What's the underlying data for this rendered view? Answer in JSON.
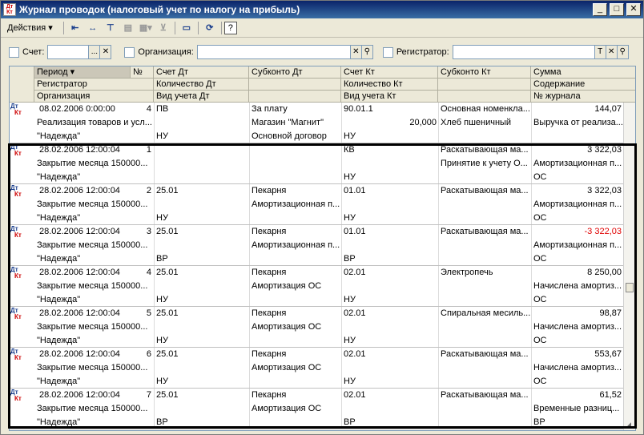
{
  "window": {
    "title": "Журнал проводок (налоговый учет по налогу на прибыль)",
    "app_icon": "1C-icon",
    "controls": [
      "_",
      "□",
      "✕"
    ]
  },
  "toolbar": {
    "actions_label": "Действия",
    "tools": [
      "arrow-left-icon",
      "expand-icon",
      "filter-icon",
      "copy-icon",
      "report-icon",
      "clear-filter-icon",
      "card-icon",
      "refresh-icon"
    ],
    "help_label": "?"
  },
  "filters": {
    "account_label": "Счет:",
    "account_value": "",
    "organization_label": "Организация:",
    "organization_value": "",
    "registrar_label": "Регистратор:",
    "registrar_value": "",
    "btn_more": "...",
    "btn_clear": "✕",
    "btn_t": "T"
  },
  "columns": {
    "row1": [
      "Период",
      "№",
      "Счет Дт",
      "Субконто Дт",
      "Счет Кт",
      "Субконто Кт",
      "Сумма"
    ],
    "row2": [
      "Регистратор",
      "Количество Дт",
      "Количество Кт",
      "Содержание"
    ],
    "row3": [
      "Организация",
      "Вид учета Дт",
      "Вид учета Кт",
      "№ журнала"
    ]
  },
  "rows": [
    {
      "icon_dt": "Дт",
      "icon_kt": "Кт",
      "period": "08.02.2006 0:00:00",
      "num": "4",
      "acc_dt": "ПВ",
      "sub_dt1": "За плату",
      "sub_dt2": "Магазин \"Магнит\"",
      "sub_dt3": "Основной договор",
      "acc_kt": "90.01.1",
      "qty_kt": "20,000",
      "sub_kt1": "Основная номенкла...",
      "sub_kt2": "Хлеб пшеничный",
      "sum": "144,07",
      "content": "Выручка от реализа...",
      "registrar": "Реализация товаров и усл...",
      "org": "\"Надежда\"",
      "vu_dt": "НУ",
      "vu_kt": "НУ",
      "journal": "",
      "negative": false
    },
    {
      "icon_dt": "Дт",
      "icon_kt": "Кт",
      "period": "28.02.2006 12:00:04",
      "num": "1",
      "acc_dt": "",
      "sub_dt1": "",
      "sub_dt2": "",
      "sub_dt3": "",
      "acc_kt": "КВ",
      "qty_kt": "",
      "sub_kt1": "Раскатывающая ма...",
      "sub_kt2": "Принятие к учету О...",
      "sum": "3 322,03",
      "content": "Амортизационная п...",
      "registrar": "Закрытие месяца 150000...",
      "org": "\"Надежда\"",
      "vu_dt": "",
      "vu_kt": "НУ",
      "journal": "ОС",
      "negative": false
    },
    {
      "icon_dt": "Дт",
      "icon_kt": "Кт",
      "period": "28.02.2006 12:00:04",
      "num": "2",
      "acc_dt": "25.01",
      "sub_dt1": "Пекарня",
      "sub_dt2": "Амортизационная п...",
      "sub_dt3": "",
      "acc_kt": "01.01",
      "qty_kt": "",
      "sub_kt1": "Раскатывающая ма...",
      "sub_kt2": "",
      "sum": "3 322,03",
      "content": "Амортизационная п...",
      "registrar": "Закрытие месяца 150000...",
      "org": "\"Надежда\"",
      "vu_dt": "НУ",
      "vu_kt": "НУ",
      "journal": "ОС",
      "negative": false
    },
    {
      "icon_dt": "Дт",
      "icon_kt": "Кт",
      "period": "28.02.2006 12:00:04",
      "num": "3",
      "acc_dt": "25.01",
      "sub_dt1": "Пекарня",
      "sub_dt2": "Амортизационная п...",
      "sub_dt3": "",
      "acc_kt": "01.01",
      "qty_kt": "",
      "sub_kt1": "Раскатывающая ма...",
      "sub_kt2": "",
      "sum": "-3 322,03",
      "content": "Амортизационная п...",
      "registrar": "Закрытие месяца 150000...",
      "org": "\"Надежда\"",
      "vu_dt": "ВР",
      "vu_kt": "ВР",
      "journal": "ОС",
      "negative": true
    },
    {
      "icon_dt": "Дт",
      "icon_kt": "Кт",
      "period": "28.02.2006 12:00:04",
      "num": "4",
      "acc_dt": "25.01",
      "sub_dt1": "Пекарня",
      "sub_dt2": "Амортизация ОС",
      "sub_dt3": "",
      "acc_kt": "02.01",
      "qty_kt": "",
      "sub_kt1": "Электропечь",
      "sub_kt2": "",
      "sum": "8 250,00",
      "content": "Начислена амортиз...",
      "registrar": "Закрытие месяца 150000...",
      "org": "\"Надежда\"",
      "vu_dt": "НУ",
      "vu_kt": "НУ",
      "journal": "ОС",
      "negative": false
    },
    {
      "icon_dt": "Дт",
      "icon_kt": "Кт",
      "period": "28.02.2006 12:00:04",
      "num": "5",
      "acc_dt": "25.01",
      "sub_dt1": "Пекарня",
      "sub_dt2": "Амортизация ОС",
      "sub_dt3": "",
      "acc_kt": "02.01",
      "qty_kt": "",
      "sub_kt1": "Спиральная месиль...",
      "sub_kt2": "",
      "sum": "98,87",
      "content": "Начислена амортиз...",
      "registrar": "Закрытие месяца 150000...",
      "org": "\"Надежда\"",
      "vu_dt": "НУ",
      "vu_kt": "НУ",
      "journal": "ОС",
      "negative": false
    },
    {
      "icon_dt": "Дт",
      "icon_kt": "Кт",
      "period": "28.02.2006 12:00:04",
      "num": "6",
      "acc_dt": "25.01",
      "sub_dt1": "Пекарня",
      "sub_dt2": "Амортизация ОС",
      "sub_dt3": "",
      "acc_kt": "02.01",
      "qty_kt": "",
      "sub_kt1": "Раскатывающая ма...",
      "sub_kt2": "",
      "sum": "553,67",
      "content": "Начислена амортиз...",
      "registrar": "Закрытие месяца 150000...",
      "org": "\"Надежда\"",
      "vu_dt": "НУ",
      "vu_kt": "НУ",
      "journal": "ОС",
      "negative": false
    },
    {
      "icon_dt": "Дт",
      "icon_kt": "Кт",
      "period": "28.02.2006 12:00:04",
      "num": "7",
      "acc_dt": "25.01",
      "sub_dt1": "Пекарня",
      "sub_dt2": "Амортизация ОС",
      "sub_dt3": "",
      "acc_kt": "02.01",
      "qty_kt": "",
      "sub_kt1": "Раскатывающая ма...",
      "sub_kt2": "",
      "sum": "61,52",
      "content": "Временные разниц...",
      "registrar": "Закрытие месяца 150000...",
      "org": "\"Надежда\"",
      "vu_dt": "ВР",
      "vu_kt": "ВР",
      "journal": "ВР",
      "negative": false
    }
  ],
  "colors": {
    "negative_sum": "#e00000",
    "titlebar": "#0a246a"
  }
}
